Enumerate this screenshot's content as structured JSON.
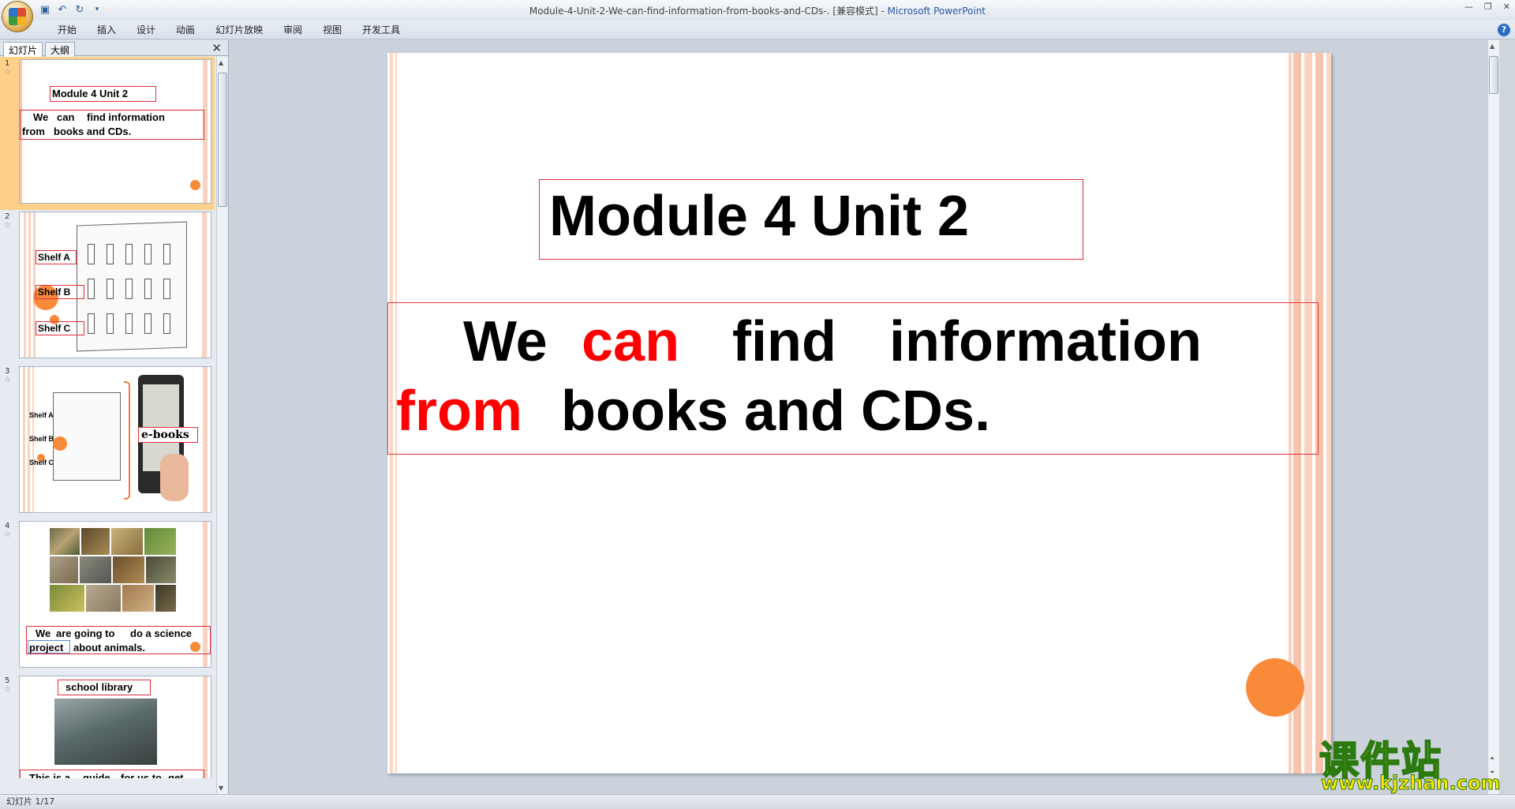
{
  "window": {
    "title": "Module-4-Unit-2-We-can-find-information-from-books-and-CDs-. [兼容模式]",
    "separator": " - ",
    "app_name": "Microsoft PowerPoint"
  },
  "ribbon": {
    "tabs": [
      "开始",
      "插入",
      "设计",
      "动画",
      "幻灯片放映",
      "审阅",
      "视图",
      "开发工具"
    ]
  },
  "panel": {
    "tab_slides": "幻灯片",
    "tab_outline": "大纲",
    "close": "✕"
  },
  "thumbnails": [
    {
      "number": "1",
      "title": "Module 4 Unit 2",
      "line1_a": "We",
      "line1_b": "can",
      "line1_c": "find   information",
      "line2_a": "from",
      "line2_b": "books  and CDs."
    },
    {
      "number": "2",
      "shelf_a": "Shelf A",
      "shelf_b": "Shelf B",
      "shelf_c": "Shelf C"
    },
    {
      "number": "3",
      "shelf_a": "Shelf A",
      "shelf_b": "Shelf B",
      "shelf_c": "Shelf C",
      "ebooks": "e-books"
    },
    {
      "number": "4",
      "line1_a": "We",
      "line1_b": "are going to",
      "line1_c": "do a science",
      "line2_a": "project",
      "line2_b": "about  animals."
    },
    {
      "number": "5",
      "title": "school  library",
      "line_a": "This is a",
      "line_b": "guide",
      "line_c": "for us to",
      "line_d": "get"
    }
  ],
  "slide": {
    "title": "Module 4 Unit 2",
    "line1": {
      "w1": "We",
      "w2": "can",
      "w3": "find",
      "w4": "information"
    },
    "line2": {
      "w1": "from",
      "w2": "books  and CDs."
    }
  },
  "status": {
    "slide_counter": "幻灯片 1/17"
  },
  "watermark": {
    "chinese": "课件站",
    "url": "www.kjzhan.com"
  },
  "colors": {
    "accent_red": "#ff0000",
    "box_border": "#e0313a",
    "orange_circle": "#f98a3a",
    "stripe": "#f7b9a0"
  }
}
